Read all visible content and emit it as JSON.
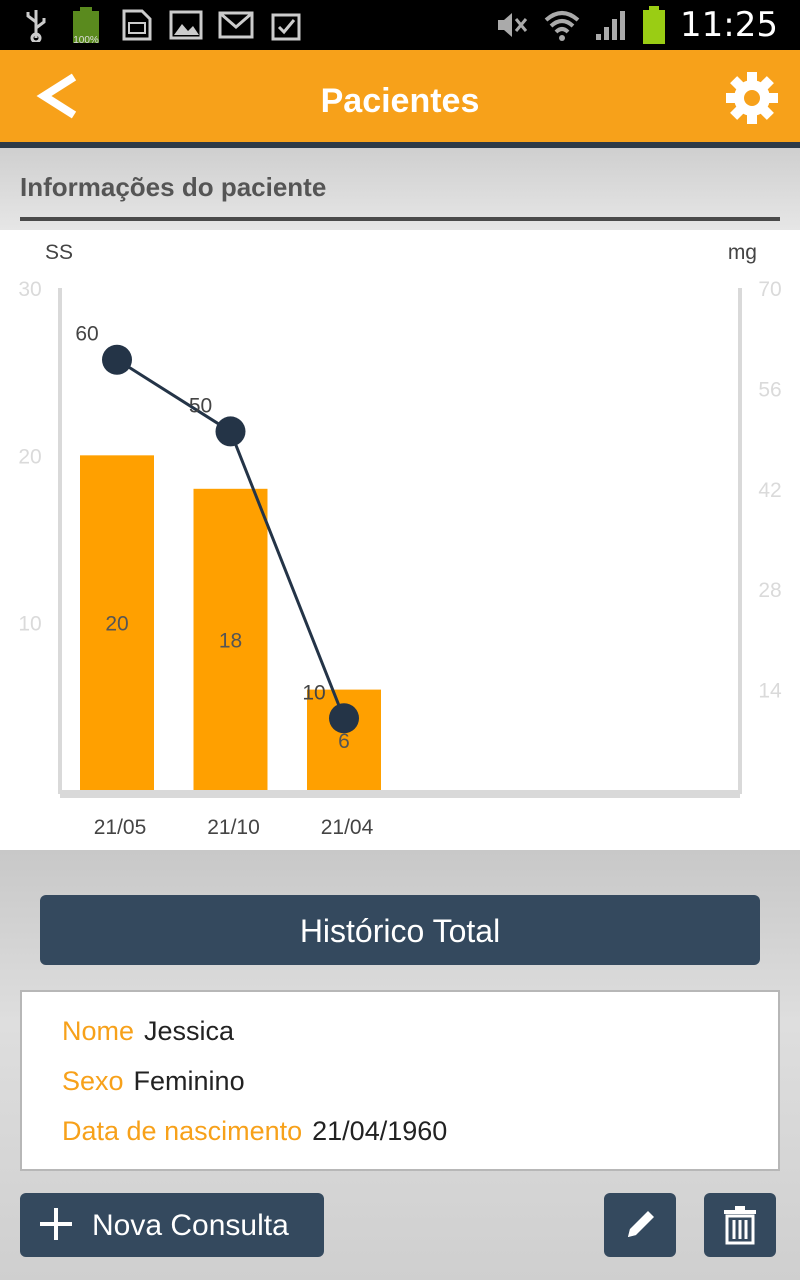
{
  "status_bar": {
    "battery_label": "100%",
    "time": "11:25",
    "icons": [
      "usb-icon",
      "battery-full-icon",
      "sd-card-icon",
      "image-icon",
      "gmail-icon",
      "clipboard-check-icon",
      "mute-icon",
      "wifi-icon",
      "signal-icon",
      "battery-icon"
    ]
  },
  "app_bar": {
    "title": "Pacientes",
    "back_icon": "back-chevron-icon",
    "settings_icon": "gear-icon",
    "color": "#f7a11a"
  },
  "section": {
    "title": "Informações do paciente"
  },
  "chart_data": {
    "type": "bar",
    "left_axis_label": "SS",
    "right_axis_label": "mg",
    "categories": [
      "21/05",
      "21/10",
      "21/04"
    ],
    "left_ticks": [
      "30",
      "20",
      "10"
    ],
    "right_ticks": [
      "70",
      "56",
      "42",
      "28",
      "14"
    ],
    "ylim_left": [
      0,
      30
    ],
    "ylim_right": [
      0,
      70
    ],
    "series": [
      {
        "type": "bar",
        "axis": "left",
        "values": [
          20,
          18,
          6
        ],
        "labels": [
          "20",
          "18",
          "6"
        ],
        "color": "#ffa000"
      },
      {
        "type": "line",
        "axis": "right",
        "values": [
          60,
          50,
          10
        ],
        "labels": [
          "60",
          "50",
          "10"
        ],
        "color": "#243447"
      }
    ]
  },
  "history_button": {
    "label": "Histórico Total"
  },
  "patient": {
    "name_label": "Nome",
    "name": "Jessica",
    "sex_label": "Sexo",
    "sex": "Feminino",
    "dob_label": "Data de nascimento",
    "dob": "21/04/1960"
  },
  "actions": {
    "new_consult_label": "Nova Consulta",
    "new_icon": "plus-icon",
    "edit_icon": "pencil-icon",
    "delete_icon": "trash-icon",
    "button_color": "#34495e"
  }
}
